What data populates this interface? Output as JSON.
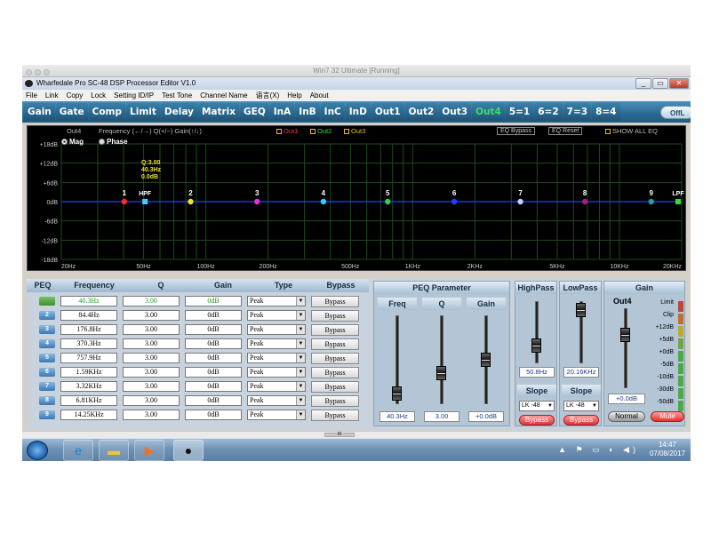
{
  "vm_title": "Win7 32 Ultimate [Running]",
  "app_title": "Wharfedale Pro SC-48 DSP Processor Editor V1.0",
  "window_buttons": [
    "_",
    "▭",
    "✕"
  ],
  "menu": [
    "File",
    "Link",
    "Copy",
    "Lock",
    "Setting ID/IP",
    "Test Tone",
    "Channel Name",
    "语言(X)",
    "Help",
    "About"
  ],
  "tabs": [
    "Gain",
    "Gate",
    "Comp",
    "Limit",
    "Delay",
    "Matrix",
    "GEQ",
    "InA",
    "InB",
    "InC",
    "InD",
    "Out1",
    "Out2",
    "Out3",
    "Out4",
    "5=1",
    "6=2",
    "7=3",
    "8=4"
  ],
  "active_tab": "Out4",
  "offline_label": "OffL",
  "graph": {
    "channel": "Out4",
    "hint": "Frequency (←/→)   Q(+/−)   Gain(↑/↓)",
    "legend": [
      {
        "label": "Out1",
        "color": "#ff3030"
      },
      {
        "label": "Out2",
        "color": "#30e030"
      },
      {
        "label": "Out3",
        "color": "#e0c030"
      }
    ],
    "eq_bypass": "EQ Bypass",
    "eq_reset": "EQ Reset",
    "show_all": "SHOW ALL EQ",
    "mag_label": "Mag",
    "phase_label": "Phase",
    "y_labels": [
      "+18dB",
      "+12dB",
      "+6dB",
      "0dB",
      "-6dB",
      "-12dB",
      "-18dB"
    ],
    "x_labels": [
      "20Hz",
      "50Hz",
      "100Hz",
      "200Hz",
      "500Hz",
      "1KHz",
      "2KHz",
      "5KHz",
      "10KHz",
      "20KHz"
    ],
    "tooltip": [
      "Q:3.00",
      "40.3Hz",
      "0.0dB"
    ],
    "points": [
      {
        "label": "1",
        "color": "#ff2a2a"
      },
      {
        "label": "HPF",
        "color": "#40d0ff"
      },
      {
        "label": "2",
        "color": "#f0e030"
      },
      {
        "label": "3",
        "color": "#e030e0"
      },
      {
        "label": "4",
        "color": "#30d0f0"
      },
      {
        "label": "5",
        "color": "#30d050"
      },
      {
        "label": "6",
        "color": "#2040ff"
      },
      {
        "label": "7",
        "color": "#c0d0ff"
      },
      {
        "label": "8",
        "color": "#a02080"
      },
      {
        "label": "9",
        "color": "#2a9a9a"
      },
      {
        "label": "LPF",
        "color": "#30e030"
      }
    ]
  },
  "peq": {
    "headers": [
      "PEQ",
      "Frequency",
      "Q",
      "Gain",
      "Type",
      "Bypass"
    ],
    "rows": [
      {
        "num": "1",
        "freq": "40.3Hz",
        "q": "3.00",
        "gain": "0dB",
        "type": "Peak",
        "bypass": "Bypass"
      },
      {
        "num": "2",
        "freq": "84.4Hz",
        "q": "3.00",
        "gain": "0dB",
        "type": "Peak",
        "bypass": "Bypass"
      },
      {
        "num": "3",
        "freq": "176.8Hz",
        "q": "3.00",
        "gain": "0dB",
        "type": "Peak",
        "bypass": "Bypass"
      },
      {
        "num": "4",
        "freq": "370.3Hz",
        "q": "3.00",
        "gain": "0dB",
        "type": "Peak",
        "bypass": "Bypass"
      },
      {
        "num": "5",
        "freq": "757.9Hz",
        "q": "3.00",
        "gain": "0dB",
        "type": "Peak",
        "bypass": "Bypass"
      },
      {
        "num": "6",
        "freq": "1.59KHz",
        "q": "3.00",
        "gain": "0dB",
        "type": "Peak",
        "bypass": "Bypass"
      },
      {
        "num": "7",
        "freq": "3.32KHz",
        "q": "3.00",
        "gain": "0dB",
        "type": "Peak",
        "bypass": "Bypass"
      },
      {
        "num": "8",
        "freq": "6.81KHz",
        "q": "3.00",
        "gain": "0dB",
        "type": "Peak",
        "bypass": "Bypass"
      },
      {
        "num": "9",
        "freq": "14.25KHz",
        "q": "3.00",
        "gain": "0dB",
        "type": "Peak",
        "bypass": "Bypass"
      }
    ]
  },
  "param": {
    "title": "PEQ Parameter",
    "freq_label": "Freq",
    "q_label": "Q",
    "gain_label": "Gain",
    "freq_value": "40.3Hz",
    "q_value": "3.00",
    "gain_value": "+0.0dB"
  },
  "highpass": {
    "title": "HighPass",
    "value": "50.8Hz",
    "slope_label": "Slope",
    "slope": "LK -48",
    "bypass": "Bypass"
  },
  "lowpass": {
    "title": "LowPass",
    "value": "20.16KHz",
    "slope_label": "Slope",
    "slope": "LK -48",
    "bypass": "Bypass"
  },
  "gain": {
    "title": "Gain",
    "channel": "Out4",
    "value": "+0.0dB",
    "normal": "Normal",
    "mute": "Mute",
    "meter_labels": [
      "Limit",
      "Clip",
      "+12dB",
      "+5dB",
      "+0dB",
      "-5dB",
      "-10dB",
      "-30dB",
      "-50dB"
    ]
  },
  "scroll_thumb": "III",
  "taskbar": {
    "time": "14:47",
    "date": "07/08/2017"
  }
}
